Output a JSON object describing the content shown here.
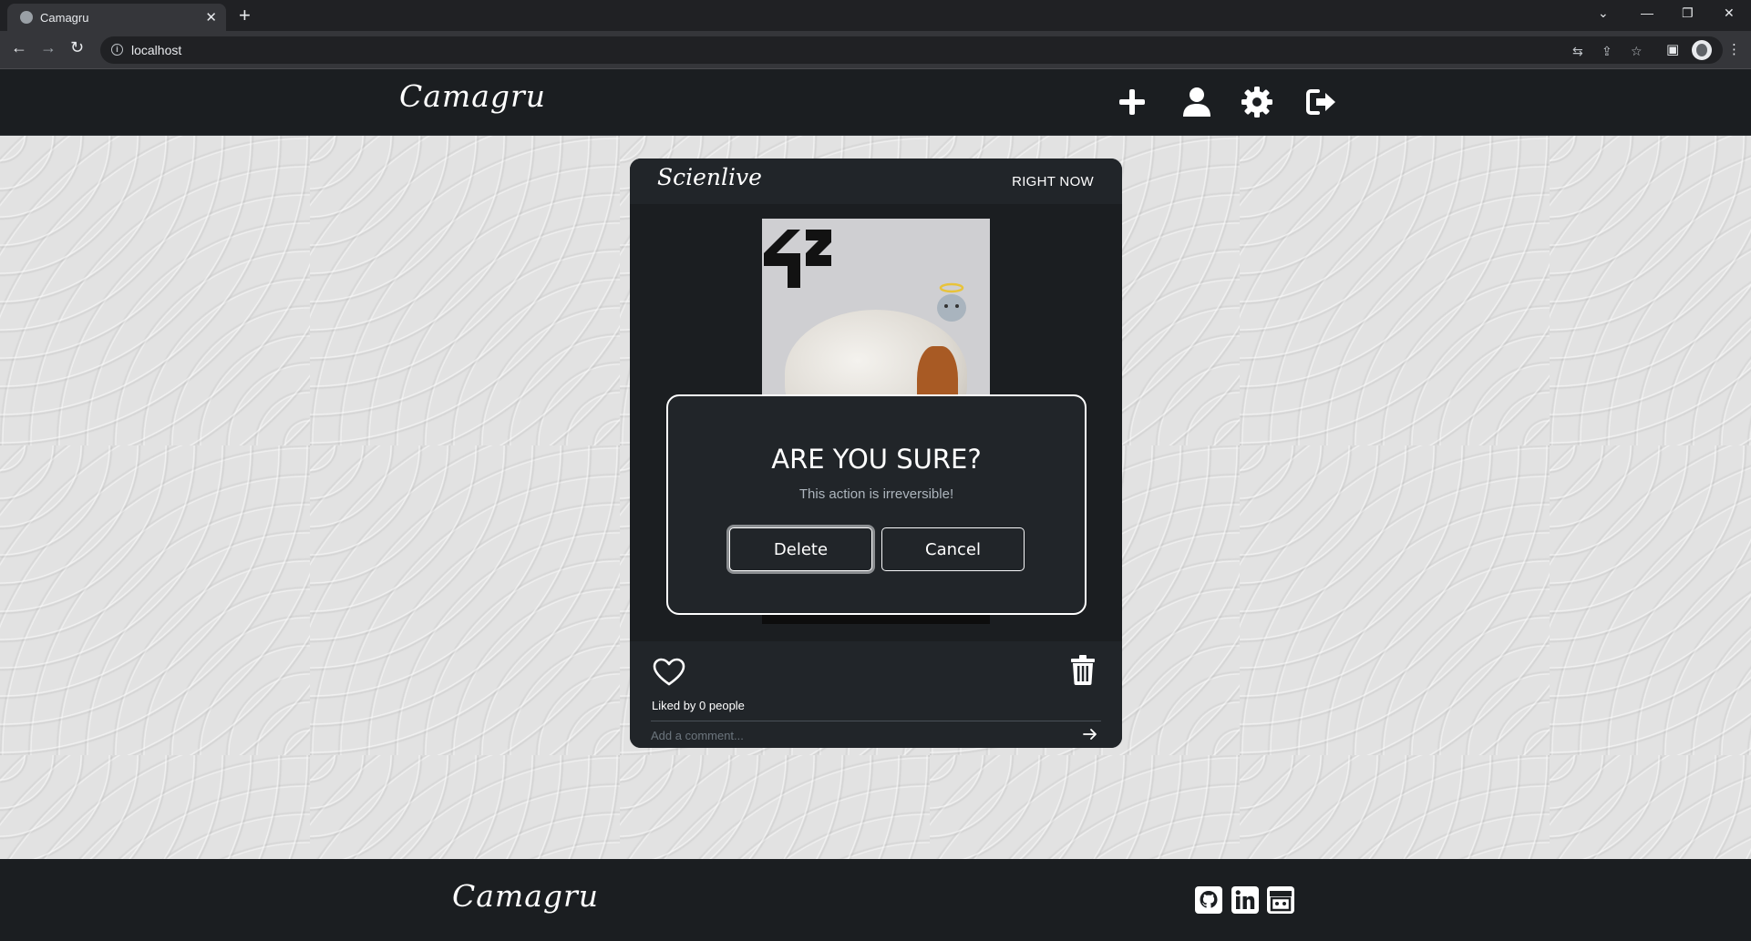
{
  "browser": {
    "tab_title": "Camagru",
    "url": "localhost"
  },
  "header": {
    "brand": "Camagru",
    "icons": [
      "plus-icon",
      "user-icon",
      "gear-icon",
      "logout-icon"
    ]
  },
  "post": {
    "author": "Scienlive",
    "time": "RIGHT NOW",
    "likes_text": "Liked by 0 people",
    "comment_placeholder": "Add a comment..."
  },
  "modal": {
    "title": "ARE YOU SURE?",
    "subtitle": "This action is irreversible!",
    "delete_label": "Delete",
    "cancel_label": "Cancel"
  },
  "footer": {
    "brand": "Camagru",
    "social": [
      "github-icon",
      "linkedin-icon",
      "store-icon"
    ]
  },
  "colors": {
    "dark_bg": "#1b1e21",
    "card_bg": "#212529",
    "pattern_bg": "#e2e2e2",
    "text": "#ffffff"
  }
}
